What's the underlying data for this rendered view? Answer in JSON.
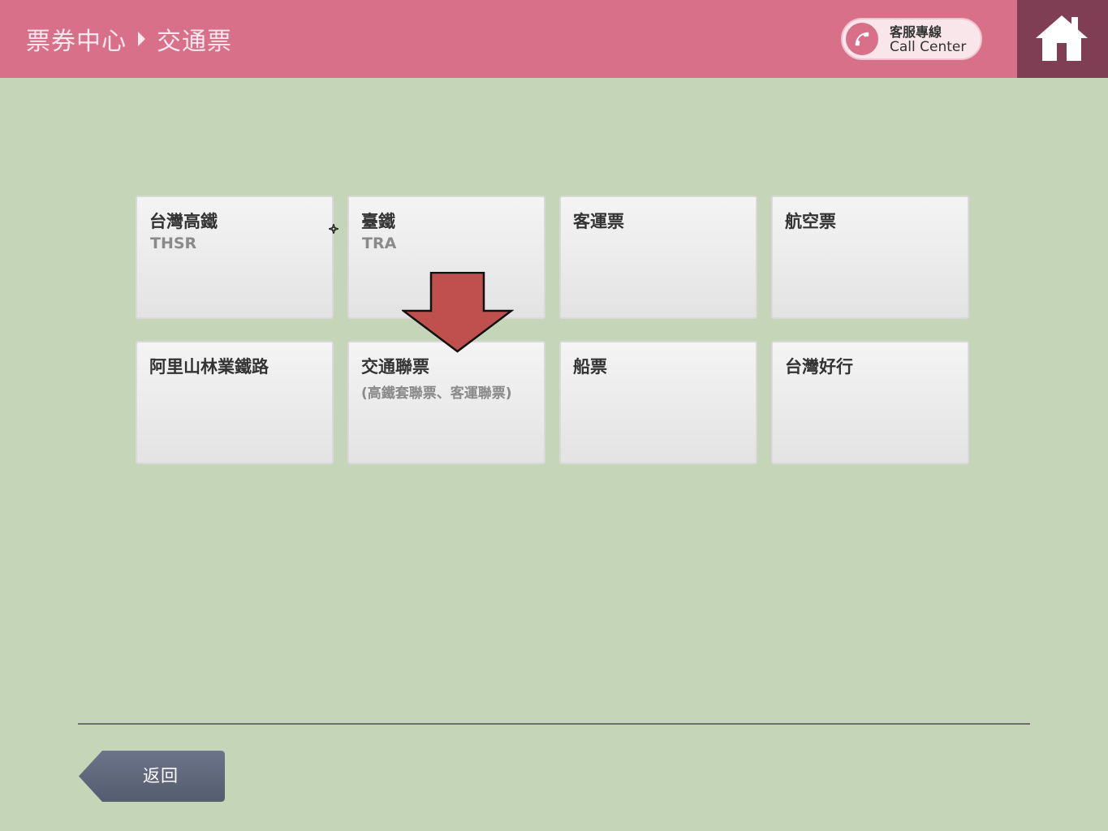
{
  "header": {
    "breadcrumb": [
      "票券中心",
      "交通票"
    ],
    "call_center": {
      "label_zh": "客服專線",
      "label_en": "Call Center"
    }
  },
  "tiles": [
    {
      "title": "台灣高鐵",
      "subtitle": "THSR"
    },
    {
      "title": "臺鐵",
      "subtitle": "TRA"
    },
    {
      "title": "客運票",
      "subtitle": ""
    },
    {
      "title": "航空票",
      "subtitle": ""
    },
    {
      "title": "阿里山林業鐵路",
      "subtitle": ""
    },
    {
      "title": "交通聯票",
      "subtitle": "(高鐵套聯票、客運聯票)"
    },
    {
      "title": "船票",
      "subtitle": ""
    },
    {
      "title": "台灣好行",
      "subtitle": ""
    }
  ],
  "footer": {
    "back_label": "返回"
  },
  "colors": {
    "header_bg": "#d8708a",
    "home_bg": "#7f3e53",
    "page_bg": "#c5d5b7",
    "arrow_fill": "#c0504d",
    "back_btn": "#5d6679"
  },
  "icons": [
    "phone-icon",
    "home-icon",
    "down-arrow-indicator",
    "back-arrow-shape"
  ]
}
